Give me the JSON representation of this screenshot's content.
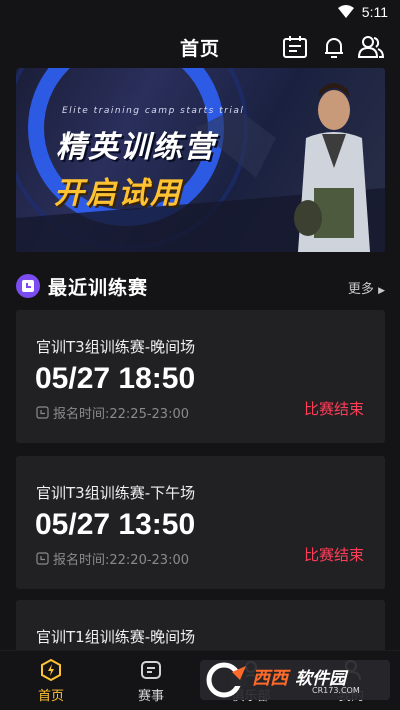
{
  "status_bar": {
    "time": "5:11"
  },
  "header": {
    "title": "首页"
  },
  "banner": {
    "subtitle": "Elite training camp starts trial",
    "title_line1": "精英训练营",
    "title_line2": "开启试用"
  },
  "section": {
    "title": "最近训练赛",
    "more_label": "更多"
  },
  "cards": [
    {
      "name": "官训T3组训练赛-晚间场",
      "time": "05/27 18:50",
      "reg": "报名时间:22:25-23:00",
      "status": "比赛结束"
    },
    {
      "name": "官训T3组训练赛-下午场",
      "time": "05/27 13:50",
      "reg": "报名时间:22:20-23:00",
      "status": "比赛结束"
    },
    {
      "name": "官训T1组训练赛-晚间场"
    }
  ],
  "tabs": [
    {
      "label": "首页"
    },
    {
      "label": "赛事"
    },
    {
      "label": "俱乐部"
    },
    {
      "label": "我的"
    }
  ],
  "watermark": {
    "brand": "西西",
    "suffix": "软件园",
    "url": "CR173.COM"
  },
  "colors": {
    "accent": "#ffc233",
    "status_end": "#ff3d57",
    "section_icon": "#7b4cf0",
    "card_bg": "#212124",
    "page_bg": "#141416"
  }
}
